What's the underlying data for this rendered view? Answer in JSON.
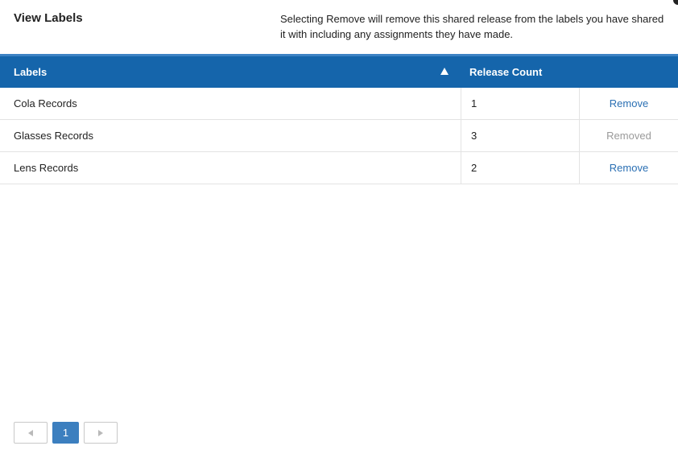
{
  "header": {
    "title": "View Labels",
    "description": "Selecting Remove will remove this shared release from the labels you have shared it with including any assignments they have made."
  },
  "table": {
    "columns": {
      "labels": "Labels",
      "release_count": "Release Count"
    },
    "sort": {
      "column": "labels",
      "direction": "ascending",
      "icon": "sort-up-icon"
    },
    "rows": [
      {
        "label": "Cola Records",
        "count": "1",
        "action": "Remove",
        "action_enabled": true
      },
      {
        "label": "Glasses Records",
        "count": "3",
        "action": "Removed",
        "action_enabled": false
      },
      {
        "label": "Lens Records",
        "count": "2",
        "action": "Remove",
        "action_enabled": true
      }
    ]
  },
  "pagination": {
    "current_page": "1",
    "prev_icon": "previous-page-icon",
    "next_icon": "next-page-icon"
  },
  "colors": {
    "header_bar": "#1565ab",
    "accent": "#3d82c4",
    "link": "#2a6fb3",
    "disabled_text": "#9a9a9a"
  }
}
